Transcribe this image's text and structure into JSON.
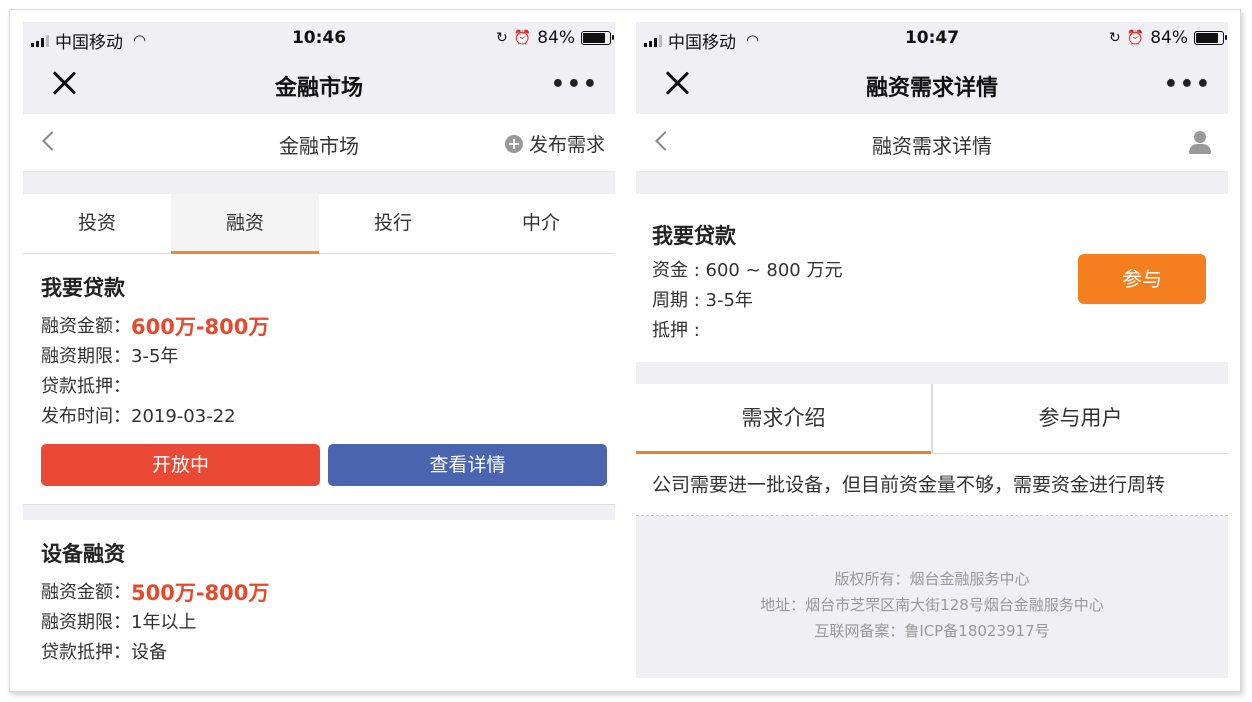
{
  "status_left": {
    "carrier": "中国移动",
    "time": "10:46",
    "battery": "84%",
    "battery_level": 0.84
  },
  "status_right": {
    "carrier": "中国移动",
    "time": "10:47",
    "battery": "84%",
    "battery_level": 0.84
  },
  "left": {
    "wx_title": "金融市场",
    "page_title": "金融市场",
    "publish_label": "发布需求",
    "tabs": [
      {
        "label": "投资",
        "active": false
      },
      {
        "label": "融资",
        "active": true
      },
      {
        "label": "投行",
        "active": false
      },
      {
        "label": "中介",
        "active": false
      }
    ],
    "listings": [
      {
        "title": "我要贷款",
        "amount_label": "融资金额：",
        "amount": "600万-800万",
        "term_label": "融资期限：",
        "term": "3-5年",
        "collateral_label": "贷款抵押：",
        "collateral": "",
        "date_label": "发布时间：",
        "date": "2019-03-22",
        "status_button": "开放中",
        "detail_button": "查看详情"
      },
      {
        "title": "设备融资",
        "amount_label": "融资金额：",
        "amount": "500万-800万",
        "term_label": "融资期限：",
        "term": "1年以上",
        "collateral_label": "贷款抵押：",
        "collateral": "设备"
      }
    ]
  },
  "right": {
    "wx_title": "融资需求详情",
    "page_title": "融资需求详情",
    "detail": {
      "title": "我要贷款",
      "funds": "资金 : 600 ~ 800 万元",
      "period": "周期 : 3-5年",
      "collateral": "抵押 :"
    },
    "join_button": "参与",
    "tabs": [
      {
        "label": "需求介绍",
        "active": true
      },
      {
        "label": "参与用户",
        "active": false
      }
    ],
    "intro": "公司需要进一批设备，但目前资金量不够，需要资金进行周转",
    "footer": {
      "copyright": "版权所有：烟台金融服务中心",
      "address": "地址：烟台市芝罘区南大街128号烟台金融服务中心",
      "icp": "互联网备案：鲁ICP备18023917号"
    }
  }
}
